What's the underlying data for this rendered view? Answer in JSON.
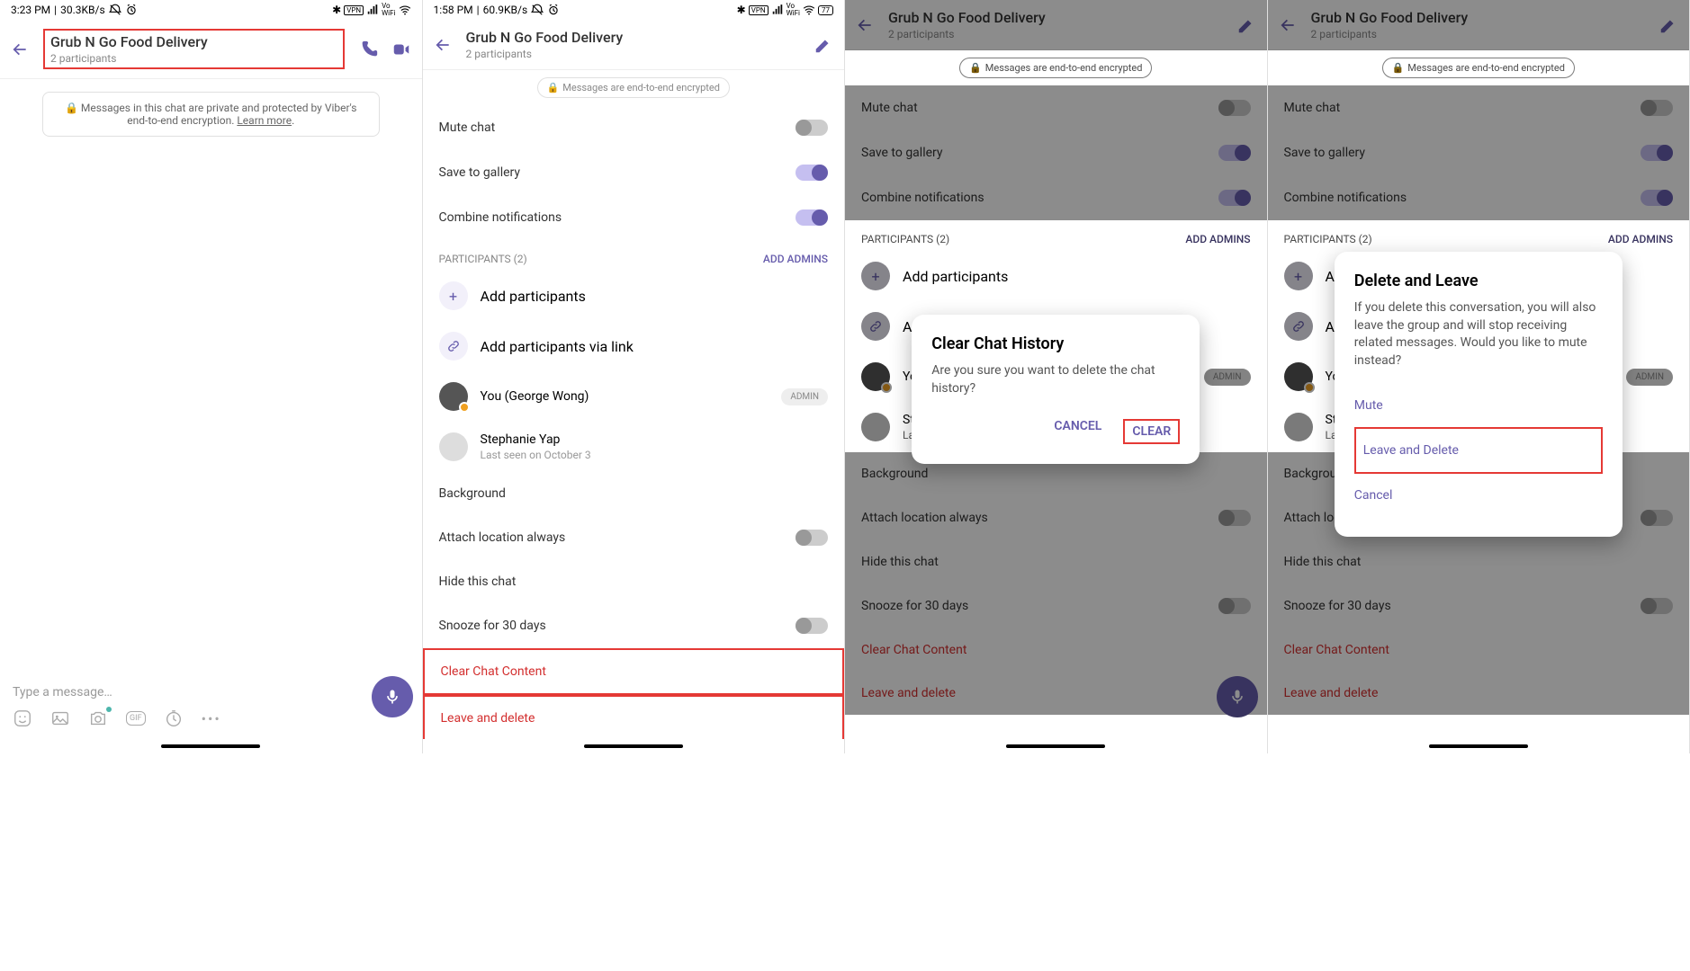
{
  "status": {
    "time1": "3:23 PM",
    "net1": "30.3KB/s",
    "time2": "1:58 PM",
    "net2": "60.9KB/s",
    "battery": "77"
  },
  "header": {
    "title": "Grub N Go Food Delivery",
    "subtitle": "2 participants"
  },
  "banner": {
    "text_a": "Messages in this chat are private and protected by Viber's end-to-end encryption. ",
    "learn": "Learn more",
    "pill": "Messages are end-to-end encrypted"
  },
  "compose": {
    "placeholder": "Type a message…"
  },
  "settings": {
    "mute": "Mute chat",
    "gallery": "Save to gallery",
    "combine": "Combine notifications",
    "participants_hdr": "PARTICIPANTS (2)",
    "add_admins": "ADD ADMINS",
    "add_part": "Add participants",
    "add_link": "Add participants via link",
    "you": "You (George Wong)",
    "admin": "ADMIN",
    "p2name": "Stephanie Yap",
    "p2sub": "Last seen on October 3",
    "background": "Background",
    "attach_loc": "Attach location always",
    "hide_chat": "Hide this chat",
    "snooze": "Snooze for 30 days",
    "clear_content": "Clear Chat Content",
    "leave_delete": "Leave and delete"
  },
  "dialog_clear": {
    "title": "Clear Chat History",
    "body": "Are you sure you want to delete the chat history?",
    "cancel": "CANCEL",
    "clear": "CLEAR"
  },
  "dialog_leave": {
    "title": "Delete and Leave",
    "body": "If you delete this conversation, you will also leave the group and will stop receiving related messages. Would you like to mute instead?",
    "mute": "Mute",
    "leave": "Leave and Delete",
    "cancel": "Cancel"
  }
}
